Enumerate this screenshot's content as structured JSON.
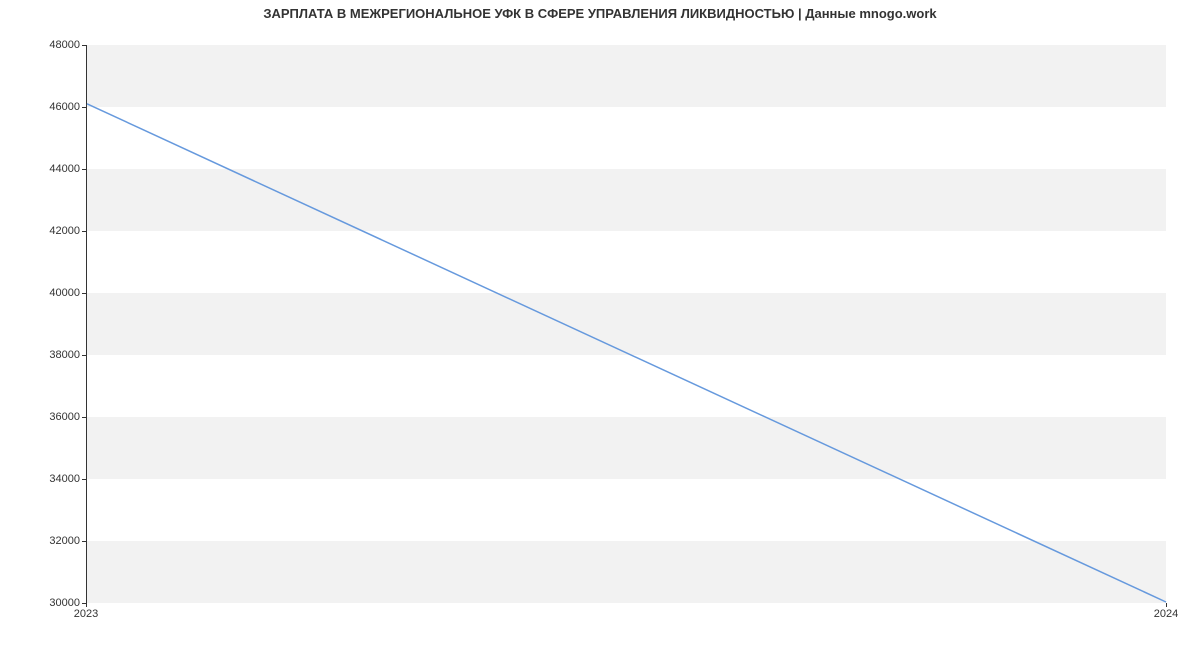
{
  "chart_data": {
    "type": "line",
    "title": "ЗАРПЛАТА В МЕЖРЕГИОНАЛЬНОЕ УФК В СФЕРЕ УПРАВЛЕНИЯ ЛИКВИДНОСТЬЮ | Данные mnogo.work",
    "x": [
      2023,
      2024
    ],
    "values": [
      46100,
      30000
    ],
    "x_ticks": [
      2023,
      2024
    ],
    "y_ticks": [
      30000,
      32000,
      34000,
      36000,
      38000,
      40000,
      42000,
      44000,
      46000,
      48000
    ],
    "xlim": [
      2023,
      2024
    ],
    "ylim": [
      30000,
      48000
    ],
    "xlabel": "",
    "ylabel": "",
    "grid": "banded",
    "colors": {
      "line": "#6699dd",
      "band": "#f2f2f2"
    }
  }
}
